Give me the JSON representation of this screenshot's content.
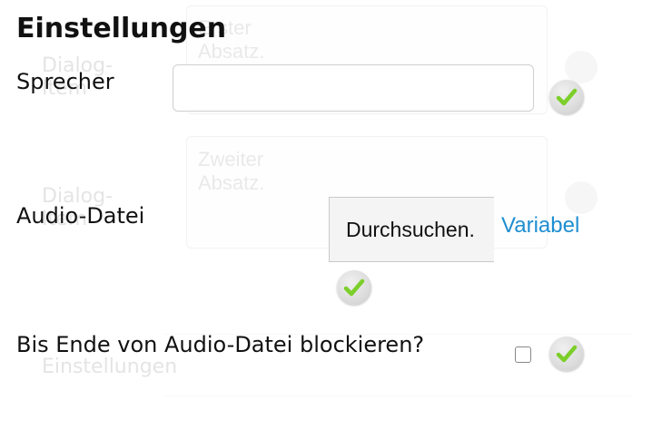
{
  "background": {
    "first_paragraph_placeholder": "Erster Absatz.",
    "second_paragraph_placeholder": "Zweiter Absatz.",
    "dialog_item_label_1": "Dialog-Item",
    "dialog_item_label_2": "Dialog-Item",
    "settings_label": "Einstellungen"
  },
  "dialog": {
    "title": "Einstellungen",
    "speaker": {
      "label": "Sprecher",
      "value": ""
    },
    "audio_file": {
      "label": "Audio-Datei",
      "browse_label": "Durchsuchen.",
      "variable_link": "Variabel"
    },
    "block_until_end": {
      "label": "Bis Ende von Audio-Datei blockieren?",
      "checked": false
    }
  },
  "colors": {
    "link": "#1e8ed0",
    "check_green": "#7ccf2a"
  },
  "icons": {
    "confirm": "checkmark-icon"
  }
}
